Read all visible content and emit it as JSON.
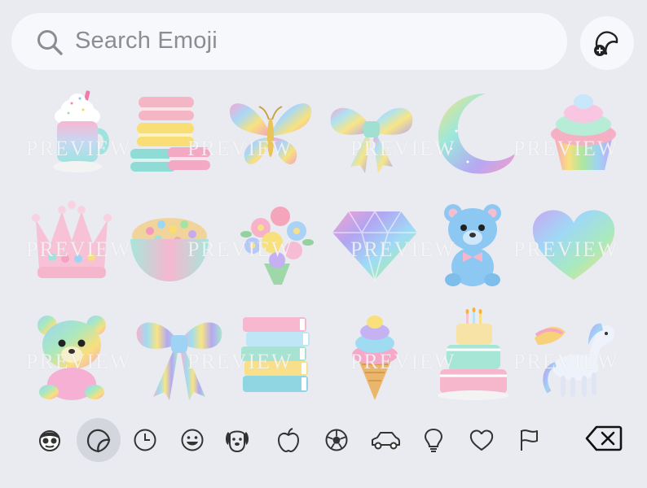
{
  "search": {
    "placeholder": "Search Emoji",
    "icon": "magnifying-glass-icon"
  },
  "sticker_button": {
    "icon": "sticker-add-icon"
  },
  "watermark_text": "PREVIEW",
  "emoji_grid": [
    [
      "milkshake",
      "macarons",
      "butterfly",
      "bow",
      "crescent-moon",
      "cupcake"
    ],
    [
      "crown",
      "cereal-bowl",
      "flower-bouquet",
      "diamond",
      "teddy-bear",
      "heart"
    ],
    [
      "rainbow-teddy-bear",
      "ribbon-bow",
      "book-stack",
      "ice-cream-cone",
      "birthday-cake",
      "pegasus"
    ]
  ],
  "category_bar": {
    "active": "stickers",
    "tabs": [
      "memoji",
      "stickers",
      "recents",
      "smileys",
      "animals",
      "food",
      "activity",
      "travel",
      "objects",
      "symbols",
      "flags"
    ],
    "delete_icon": "delete-backspace-icon"
  }
}
